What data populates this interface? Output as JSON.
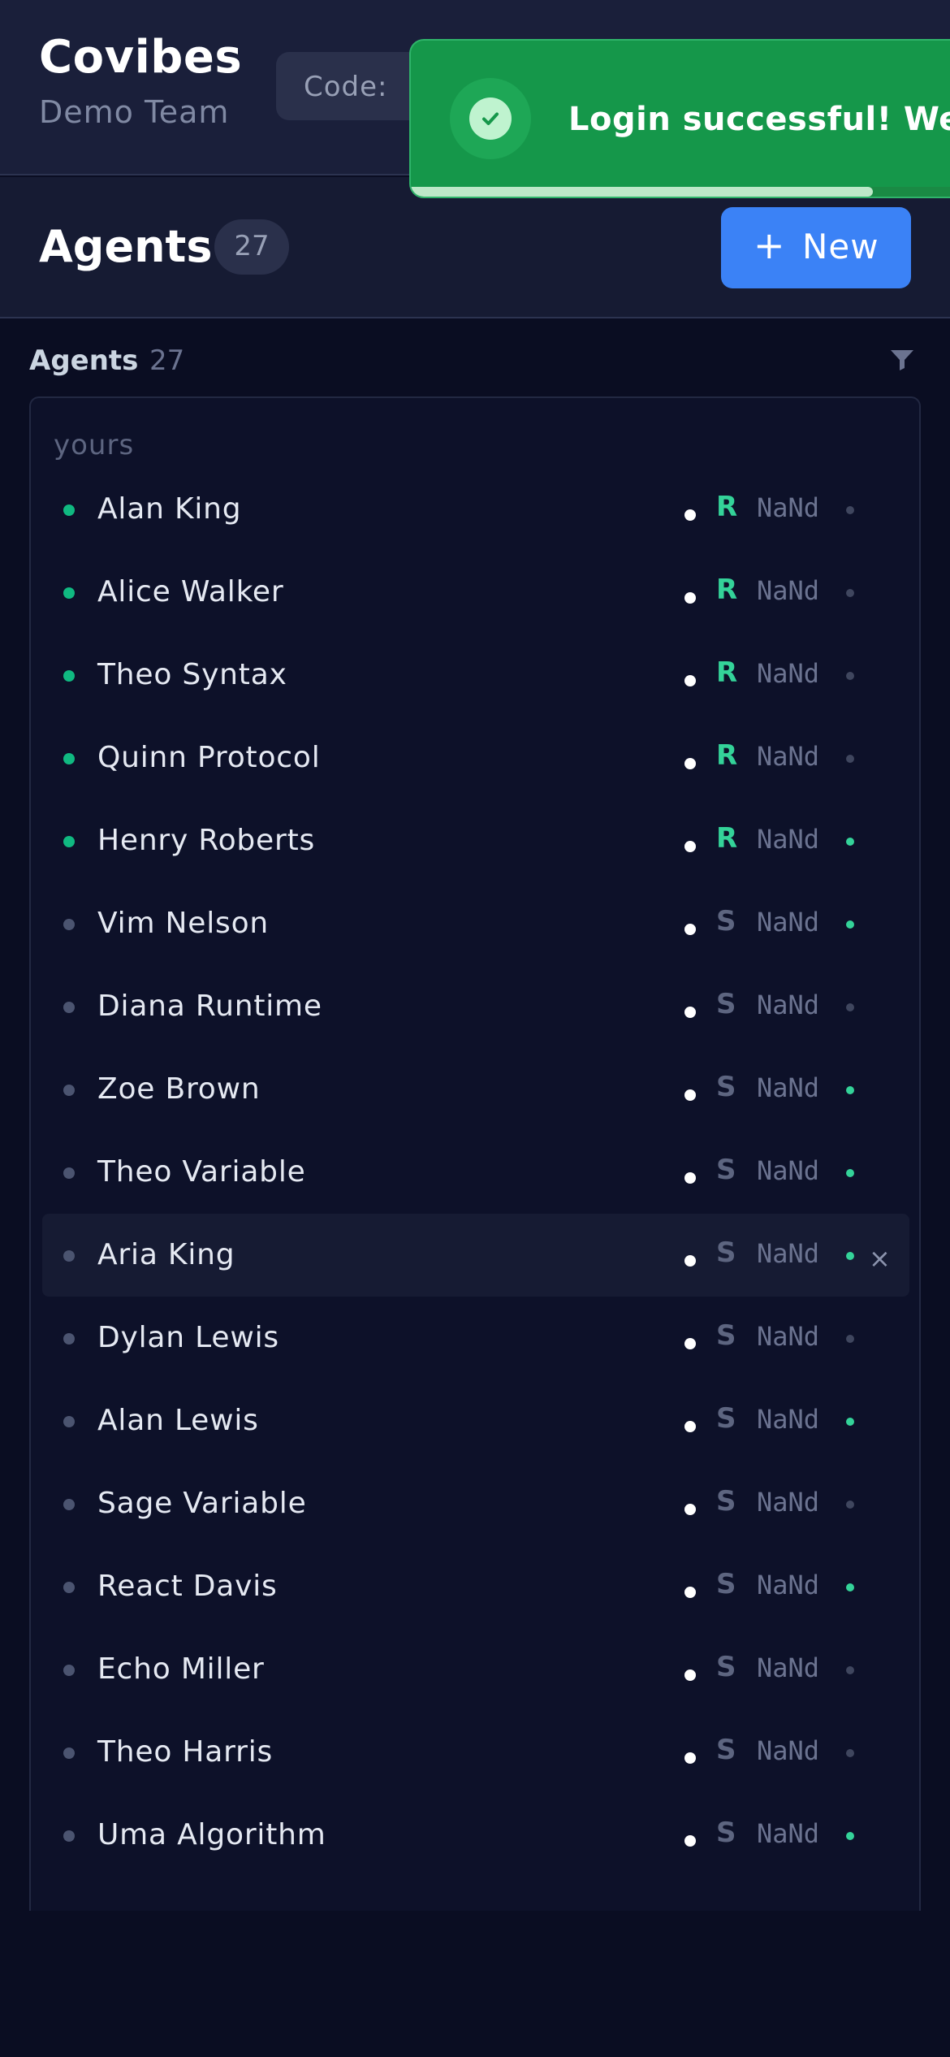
{
  "app": {
    "title": "Covibes",
    "team": "Demo Team",
    "code_label": "Code:"
  },
  "toast": {
    "message": "Login successful! Welc",
    "icon": "check-circle-icon",
    "progress_fraction": 0.79,
    "color": "#15974a"
  },
  "subheader": {
    "title": "Agents",
    "count": "27",
    "new_button": {
      "icon": "plus-icon",
      "label": "+",
      "text": "New"
    }
  },
  "list": {
    "title": "Agents",
    "count": "27",
    "filter_icon": "filter-icon",
    "group": "yours",
    "rows": [
      {
        "name": "Alan King",
        "role": "R",
        "stat": "NaNd",
        "active": true,
        "online": false
      },
      {
        "name": "Alice Walker",
        "role": "R",
        "stat": "NaNd",
        "active": true,
        "online": false
      },
      {
        "name": "Theo Syntax",
        "role": "R",
        "stat": "NaNd",
        "active": true,
        "online": false
      },
      {
        "name": "Quinn Protocol",
        "role": "R",
        "stat": "NaNd",
        "active": true,
        "online": false
      },
      {
        "name": "Henry Roberts",
        "role": "R",
        "stat": "NaNd",
        "active": true,
        "online": true
      },
      {
        "name": "Vim Nelson",
        "role": "S",
        "stat": "NaNd",
        "active": false,
        "online": true
      },
      {
        "name": "Diana Runtime",
        "role": "S",
        "stat": "NaNd",
        "active": false,
        "online": false
      },
      {
        "name": "Zoe Brown",
        "role": "S",
        "stat": "NaNd",
        "active": false,
        "online": true
      },
      {
        "name": "Theo Variable",
        "role": "S",
        "stat": "NaNd",
        "active": false,
        "online": true
      },
      {
        "name": "Aria King",
        "role": "S",
        "stat": "NaNd",
        "active": false,
        "online": true,
        "hover": true,
        "close": "×"
      },
      {
        "name": "Dylan Lewis",
        "role": "S",
        "stat": "NaNd",
        "active": false,
        "online": false
      },
      {
        "name": "Alan Lewis",
        "role": "S",
        "stat": "NaNd",
        "active": false,
        "online": true
      },
      {
        "name": "Sage Variable",
        "role": "S",
        "stat": "NaNd",
        "active": false,
        "online": false
      },
      {
        "name": "React Davis",
        "role": "S",
        "stat": "NaNd",
        "active": false,
        "online": true
      },
      {
        "name": "Echo Miller",
        "role": "S",
        "stat": "NaNd",
        "active": false,
        "online": false
      },
      {
        "name": "Theo Harris",
        "role": "S",
        "stat": "NaNd",
        "active": false,
        "online": false
      },
      {
        "name": "Uma Algorithm",
        "role": "S",
        "stat": "NaNd",
        "active": false,
        "online": true
      }
    ]
  },
  "colors": {
    "active_dot": "#10b981",
    "inactive_dot": "#4b5470",
    "role_r": "#34d399",
    "role_s": "#5d6580",
    "online": "#34d399",
    "offline": "#3f465e",
    "accent": "#3b82f6"
  }
}
